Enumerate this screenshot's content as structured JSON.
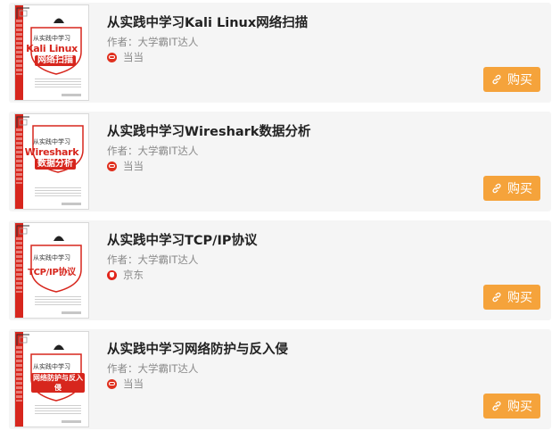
{
  "books": [
    {
      "title": "从实践中学习Kali Linux网络扫描",
      "author": "作者：大学霸IT达人",
      "store": "当当",
      "store_icon": "dangdang-icon",
      "cover": {
        "top": "从实践中学习",
        "main": "Kali Linux",
        "sub": "网络扫描"
      },
      "buy_label": "购买"
    },
    {
      "title": "从实践中学习Wireshark数据分析",
      "author": "作者：大学霸IT达人",
      "store": "当当",
      "store_icon": "dangdang-icon",
      "cover": {
        "top": "从实践中学习",
        "main": "Wireshark",
        "sub": "数据分析"
      },
      "buy_label": "购买"
    },
    {
      "title": "从实践中学习TCP/IP协议",
      "author": "作者：大学霸IT达人",
      "store": "京东",
      "store_icon": "jd-icon",
      "cover": {
        "top": "从实践中学习",
        "main": "TCP/IP协议",
        "sub": ""
      },
      "buy_label": "购买"
    },
    {
      "title": "从实践中学习网络防护与反入侵",
      "author": "作者：大学霸IT达人",
      "store": "当当",
      "store_icon": "dangdang-icon",
      "cover": {
        "top": "从实践中学习",
        "main": "网络防护与反入侵",
        "sub": ""
      },
      "buy_label": "购买"
    }
  ],
  "colors": {
    "accent": "#f5a33b",
    "brand_red": "#d7261d",
    "card_bg": "#f5f5f5"
  }
}
